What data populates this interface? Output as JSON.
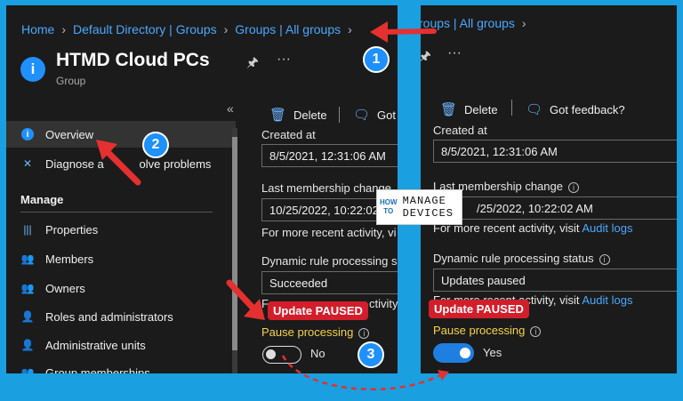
{
  "left": {
    "breadcrumb": [
      "Home",
      "Default Directory | Groups",
      "Groups | All groups"
    ],
    "title": "HTMD Cloud PCs",
    "subtitle": "Group",
    "toolbar": {
      "delete": "Delete",
      "feedback": "Got"
    },
    "sidebar": {
      "top_items": [
        {
          "label": "Overview",
          "icon": "info-icon"
        },
        {
          "label": "Diagnose a           olve problems",
          "icon": "wrench-icon"
        }
      ],
      "section": "Manage",
      "items": [
        {
          "label": "Properties",
          "icon": "properties-icon"
        },
        {
          "label": "Members",
          "icon": "members-icon"
        },
        {
          "label": "Owners",
          "icon": "owners-icon"
        },
        {
          "label": "Roles and administrators",
          "icon": "roles-icon"
        },
        {
          "label": "Administrative units",
          "icon": "admin-units-icon"
        },
        {
          "label": "Group memberships",
          "icon": "group-icon"
        }
      ]
    },
    "created_label": "Created at",
    "created_value": "8/5/2021, 12:31:06 AM",
    "membership_label": "Last membership change",
    "membership_value": "10/25/2022, 10:22:02",
    "recent_text": "For more recent activity, vi",
    "dynamic_label": "Dynamic rule processing s",
    "dynamic_value": "Succeeded",
    "dynamic_tail": "F",
    "dynamic_tail2": "ctivity, vi",
    "badge": "Update PAUSED",
    "pause_label": "Pause processing",
    "toggle_value": "No"
  },
  "right": {
    "breadcrumb": "roups | All groups",
    "toolbar": {
      "delete": "Delete",
      "feedback": "Got feedback?"
    },
    "created_label": "Created at",
    "created_value": "8/5/2021, 12:31:06 AM",
    "membership_label": "Last membership change",
    "membership_value": "/25/2022, 10:22:02 AM",
    "recent_text": "For more recent activity, visit",
    "recent_link": "Audit logs",
    "dynamic_label": "Dynamic rule processing status",
    "dynamic_value": "Updates paused",
    "recent_text2": "For more recent activity, visit",
    "recent_link2": "Audit logs",
    "badge": "Update PAUSED",
    "pause_label": "Pause processing",
    "toggle_value": "Yes"
  },
  "callouts": [
    "1",
    "2",
    "3"
  ],
  "logo": {
    "how": "HOW",
    "to": "TO",
    "manage": "MANAGE",
    "devices": "DEVICES"
  },
  "colors": {
    "accent": "#1a9fe0",
    "badge": "#d21e2b",
    "arrow": "#e53030",
    "toggle_on": "#1e7fe0"
  }
}
